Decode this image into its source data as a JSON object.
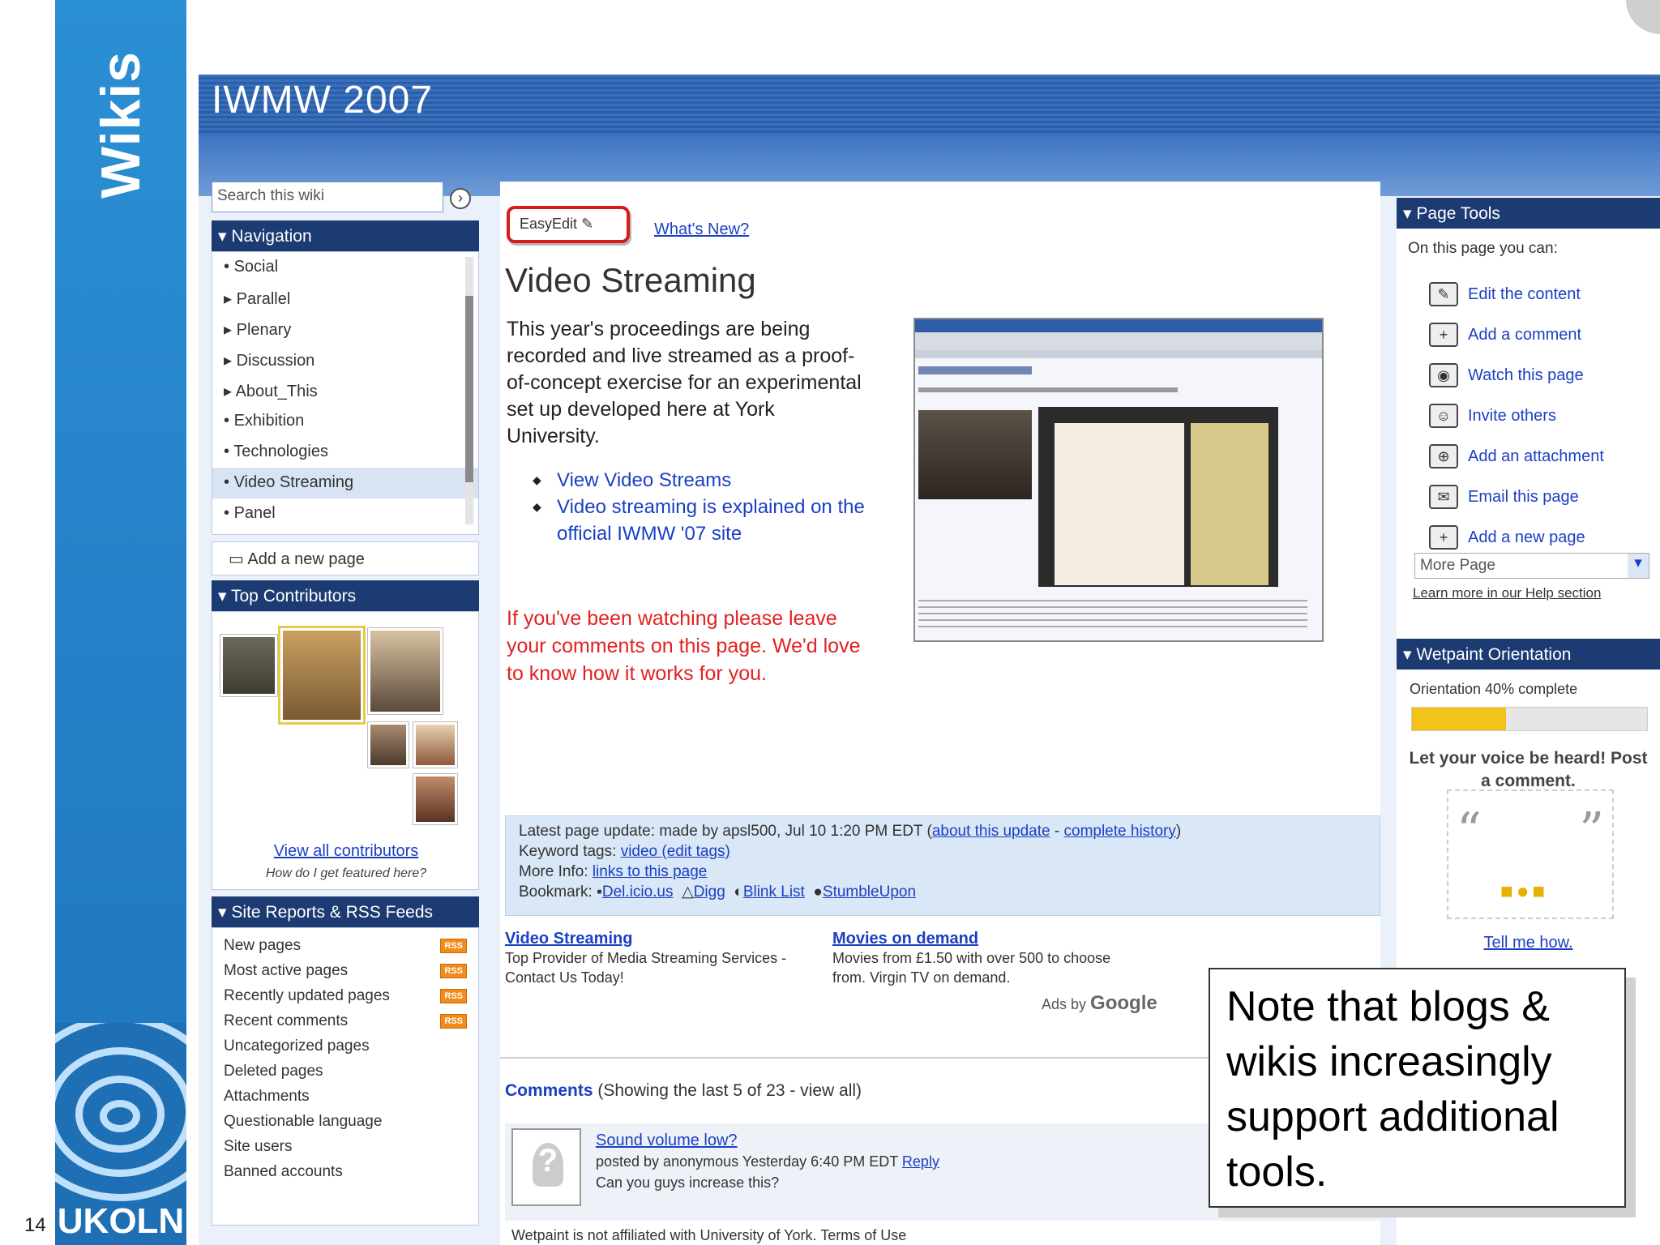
{
  "slide": {
    "title": "Wikis",
    "number": "14",
    "logo_text": "UKOLN",
    "callout": "Note that blogs & wikis increasingly support additional tools."
  },
  "site": {
    "title": "IWMW 2007"
  },
  "search": {
    "placeholder": "Search this wiki"
  },
  "navigation": {
    "heading": "Navigation",
    "items": [
      "Social",
      "Parallel",
      "Plenary",
      "Discussion",
      "About_This",
      "Exhibition",
      "Technologies",
      "Video Streaming",
      "Panel"
    ],
    "add_page": "Add a new page"
  },
  "contributors": {
    "heading": "Top Contributors",
    "view_all": "View all contributors",
    "featured": "How do I get featured here?"
  },
  "site_reports": {
    "heading": "Site Reports & RSS Feeds",
    "items": [
      "New pages",
      "Most active pages",
      "Recently updated pages",
      "Recent comments",
      "Uncategorized pages",
      "Deleted pages",
      "Attachments",
      "Questionable language",
      "Site users",
      "Banned accounts"
    ],
    "badge": "RSS"
  },
  "main": {
    "easyedit": "EasyEdit",
    "whats_new": "What's New?",
    "heading": "Video Streaming",
    "intro": "This year's proceedings are being recorded and live streamed as a proof-of-concept exercise for an experimental set up developed here at York University.",
    "links": [
      "View Video Streams",
      "Video streaming is explained on the official IWMW '07 site"
    ],
    "feedback": "If you've been watching please leave your comments on this page. We'd love to know how it works for you.",
    "update_line1": "Latest page update: made by apsl500, Jul 10 1:20 PM EDT",
    "update_about": "about this update",
    "update_history": "complete history",
    "keyword_label": "Keyword tags:",
    "keyword_value": "video (edit tags)",
    "more_info_label": "More Info:",
    "more_info_value": "links to this page",
    "bookmark_label": "Bookmark:",
    "bookmarks": [
      "Del.icio.us",
      "Digg",
      "Blink List",
      "StumbleUpon"
    ],
    "ads": [
      {
        "title": "Video Streaming",
        "text": "Top Provider of Media Streaming Services - Contact Us Today!"
      },
      {
        "title": "Movies on demand",
        "text": "Movies from £1.50 with over 500 to choose from. Virgin TV on demand."
      }
    ],
    "ads_by": "Ads by",
    "google": "Google",
    "comments_heading": "Comments",
    "comments_count": "(Showing the last 5 of 23 - view all)",
    "comment_title": "Sound volume low?",
    "comment_meta": "posted by anonymous Yesterday 6:40 PM EDT",
    "comment_reply": "Reply",
    "comment_body": "Can you guys increase this?",
    "footer": "Ads by Google",
    "footer_line": "Wetpaint is not affiliated with University of York. Terms of Use"
  },
  "page_tools": {
    "heading": "Page Tools",
    "intro": "On this page you can:",
    "items": [
      {
        "label": "Edit the content",
        "icon": "pencil-icon"
      },
      {
        "label": "Add a comment",
        "icon": "comment-icon"
      },
      {
        "label": "Watch this page",
        "icon": "watch-icon"
      },
      {
        "label": "Invite others",
        "icon": "people-icon"
      },
      {
        "label": "Add an attachment",
        "icon": "attachment-icon"
      },
      {
        "label": "Email this page",
        "icon": "email-icon"
      },
      {
        "label": "Add a new page",
        "icon": "new-page-icon"
      }
    ],
    "more": "More Page",
    "learn_more": "Learn more in our Help section"
  },
  "orientation": {
    "heading": "Wetpaint Orientation",
    "progress_label": "Orientation 40% complete",
    "progress": 0.4,
    "prompt": "Let your voice be heard! Post a comment.",
    "tell_me": "Tell me how."
  },
  "colors": {
    "slide_blue": "#1f74bb",
    "nav_dark": "#1d3b73",
    "link": "#1a3fc5",
    "feedback_red": "#e32121",
    "progress_yellow": "#f3c31b"
  }
}
